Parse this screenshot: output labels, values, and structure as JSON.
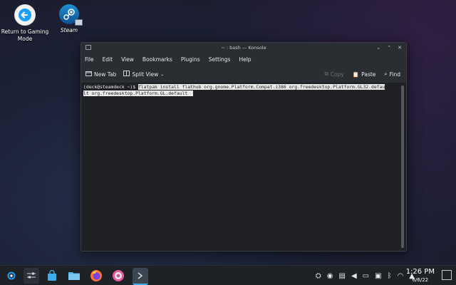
{
  "desktop": {
    "return_label": "Return to Gaming Mode",
    "steam_label": "Steam"
  },
  "window": {
    "title": "~ : bash — Konsole",
    "buttons": {
      "minimize": "⌄",
      "maximize": "⌃",
      "close": "✕"
    }
  },
  "menu": [
    "File",
    "Edit",
    "View",
    "Bookmarks",
    "Plugins",
    "Settings",
    "Help"
  ],
  "toolbar": {
    "new_tab": "New Tab",
    "split_view": "Split View",
    "copy": "Copy",
    "paste": "Paste",
    "find": "Find"
  },
  "terminal": {
    "prompt": "(deck@steamdeck ~)$ ",
    "command_line1": "flatpak install flathub org.gnome.Platform.Compat.i386 org.freedesktop.Platform.GL32.defau",
    "command_line2": "lt org.freedesktop.Platform.GL.default "
  },
  "clock": {
    "time": "1:26 PM",
    "date": "6/6/22"
  },
  "tray_icons": [
    "clipboard-icon",
    "steam-tray-icon",
    "notes-icon",
    "volume-icon",
    "battery-icon",
    "usb-icon",
    "bluetooth-icon",
    "wifi-icon",
    "expand-tray-icon"
  ],
  "colors": {
    "accent": "#3daee9",
    "window_bg": "#232629",
    "terminal_bg": "#1f2124"
  }
}
